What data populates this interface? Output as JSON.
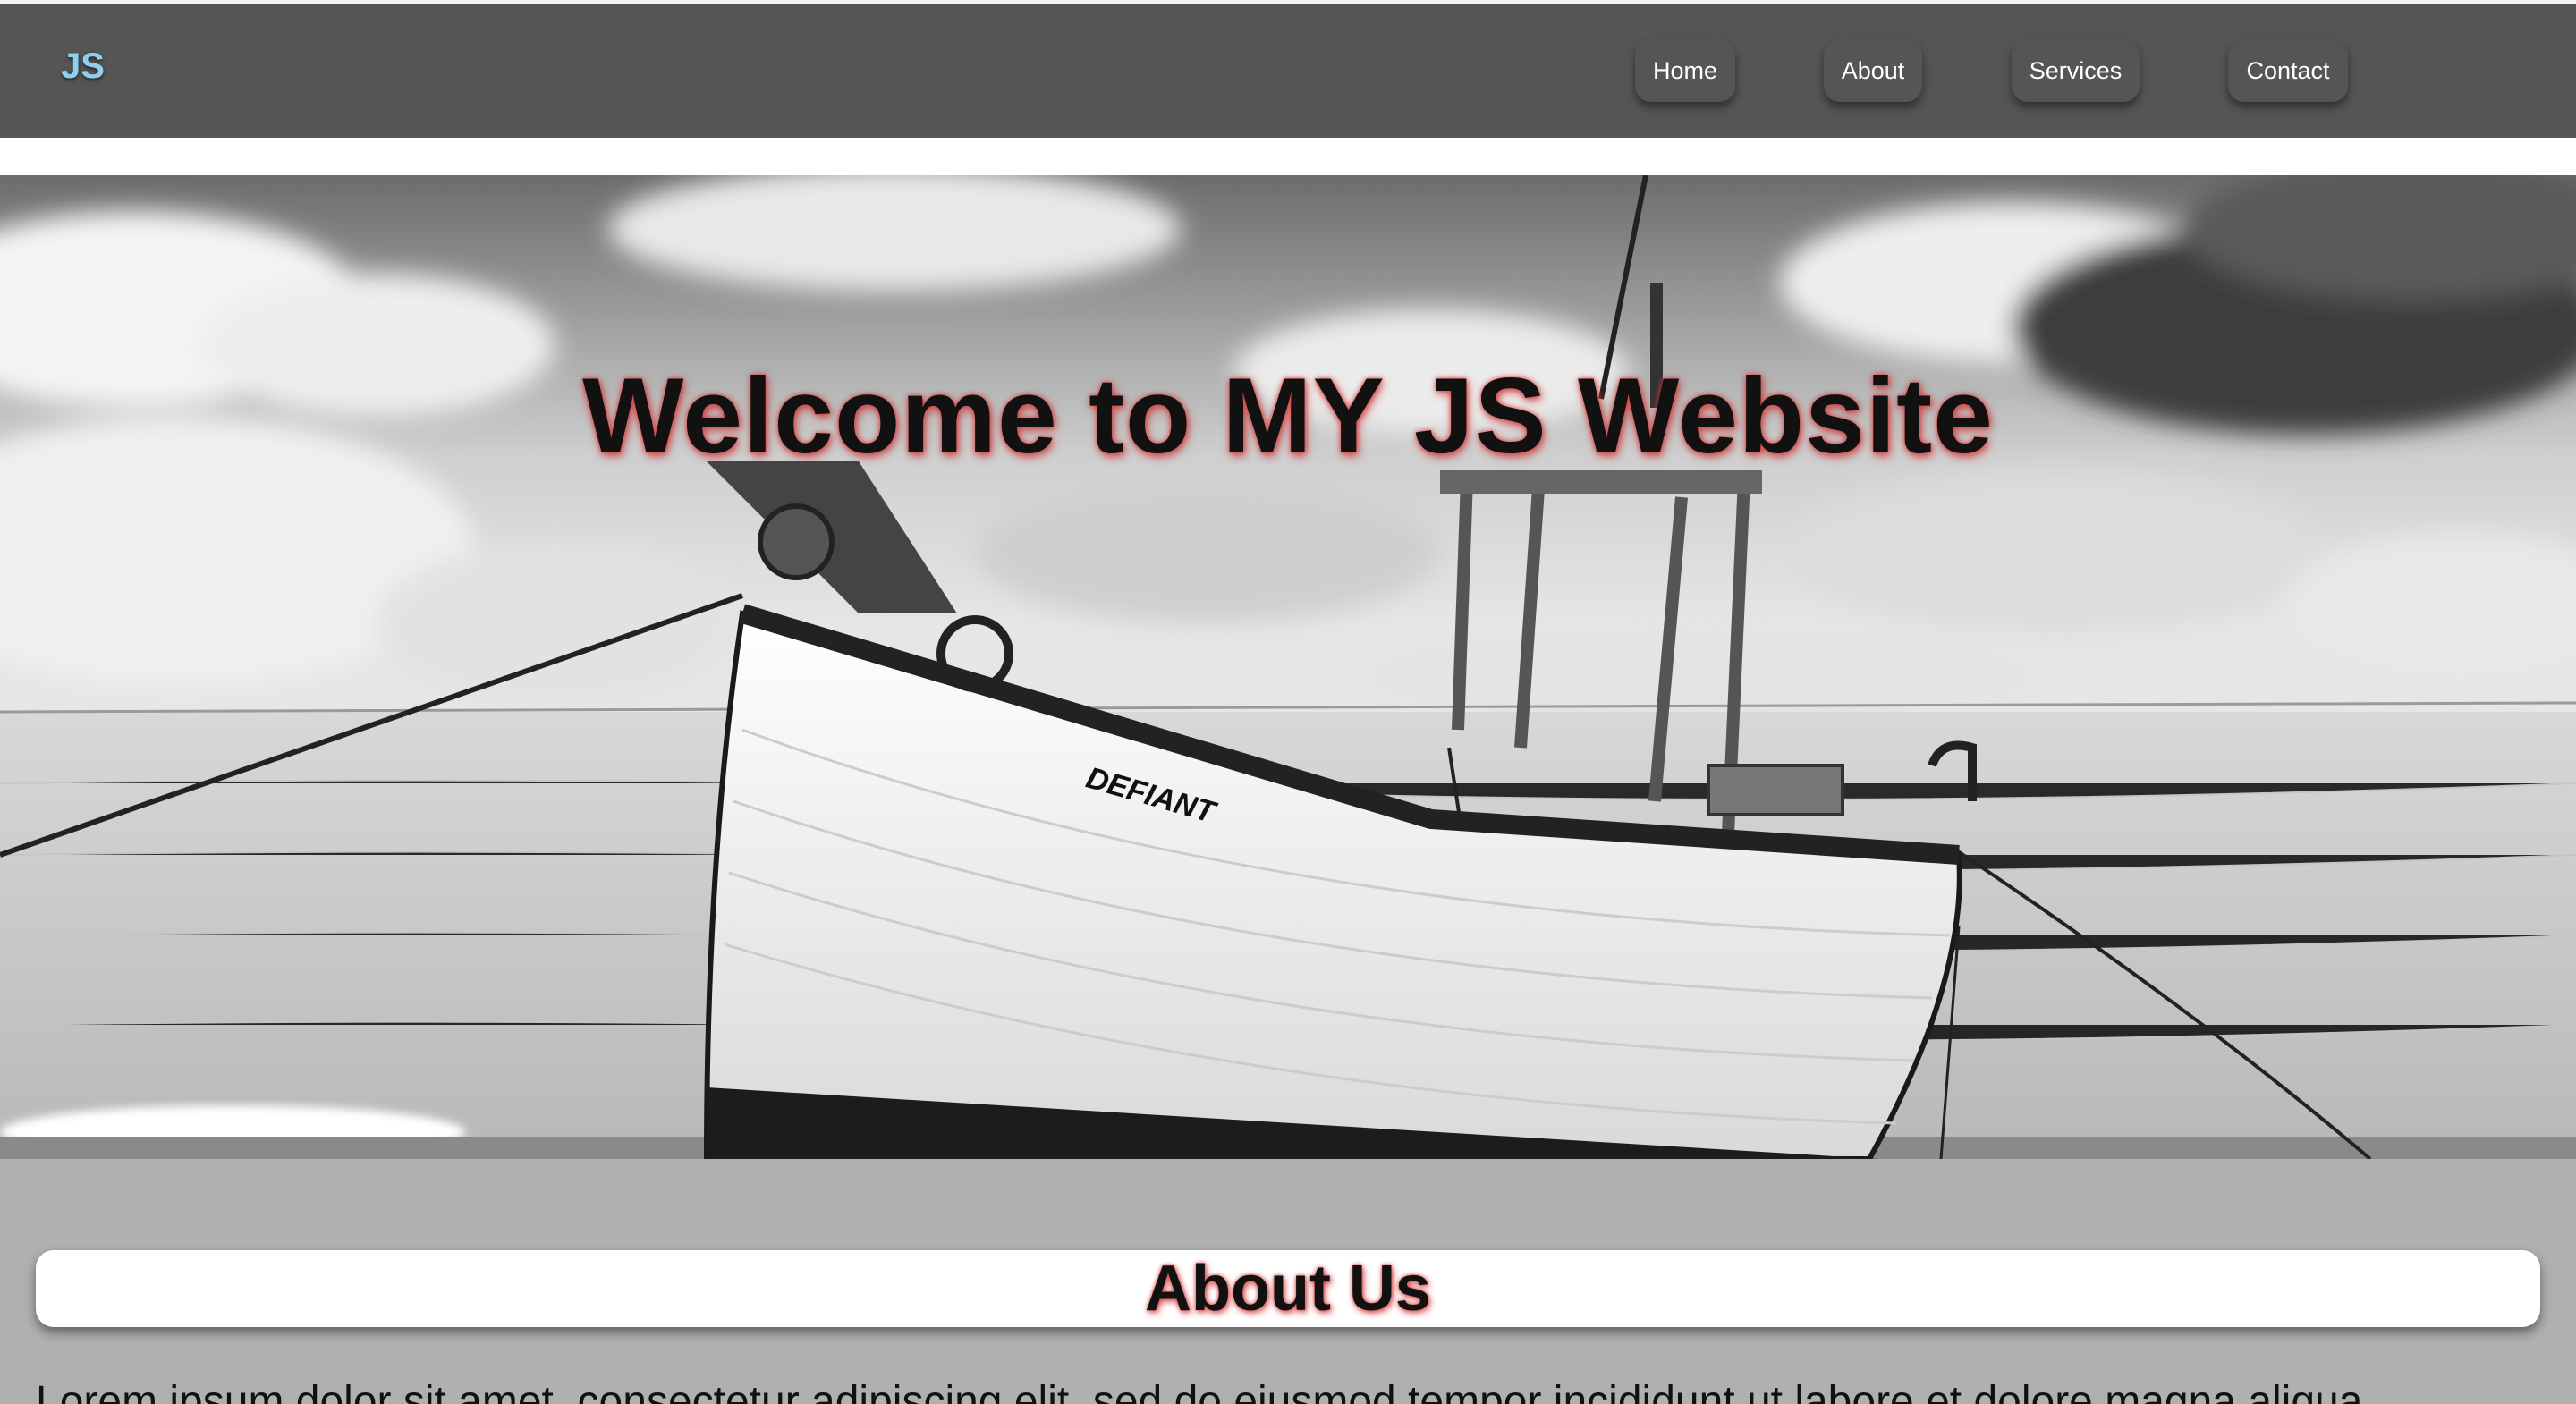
{
  "nav": {
    "logo": "JS",
    "items": [
      {
        "label": "Home"
      },
      {
        "label": "About"
      },
      {
        "label": "Services"
      },
      {
        "label": "Contact"
      }
    ]
  },
  "hero": {
    "title": "Welcome to MY JS Website",
    "boat_name": "DEFIANT"
  },
  "about": {
    "heading": "About Us",
    "body": "Lorem ipsum dolor sit amet, consectetur adipiscing elit, sed do eiusmod tempor incididunt ut labore et dolore magna aliqua."
  },
  "colors": {
    "navbar": "#555555",
    "logo": "#8fd0f0",
    "page_bg": "#b0b0b0",
    "title_glow": "#e04040"
  }
}
